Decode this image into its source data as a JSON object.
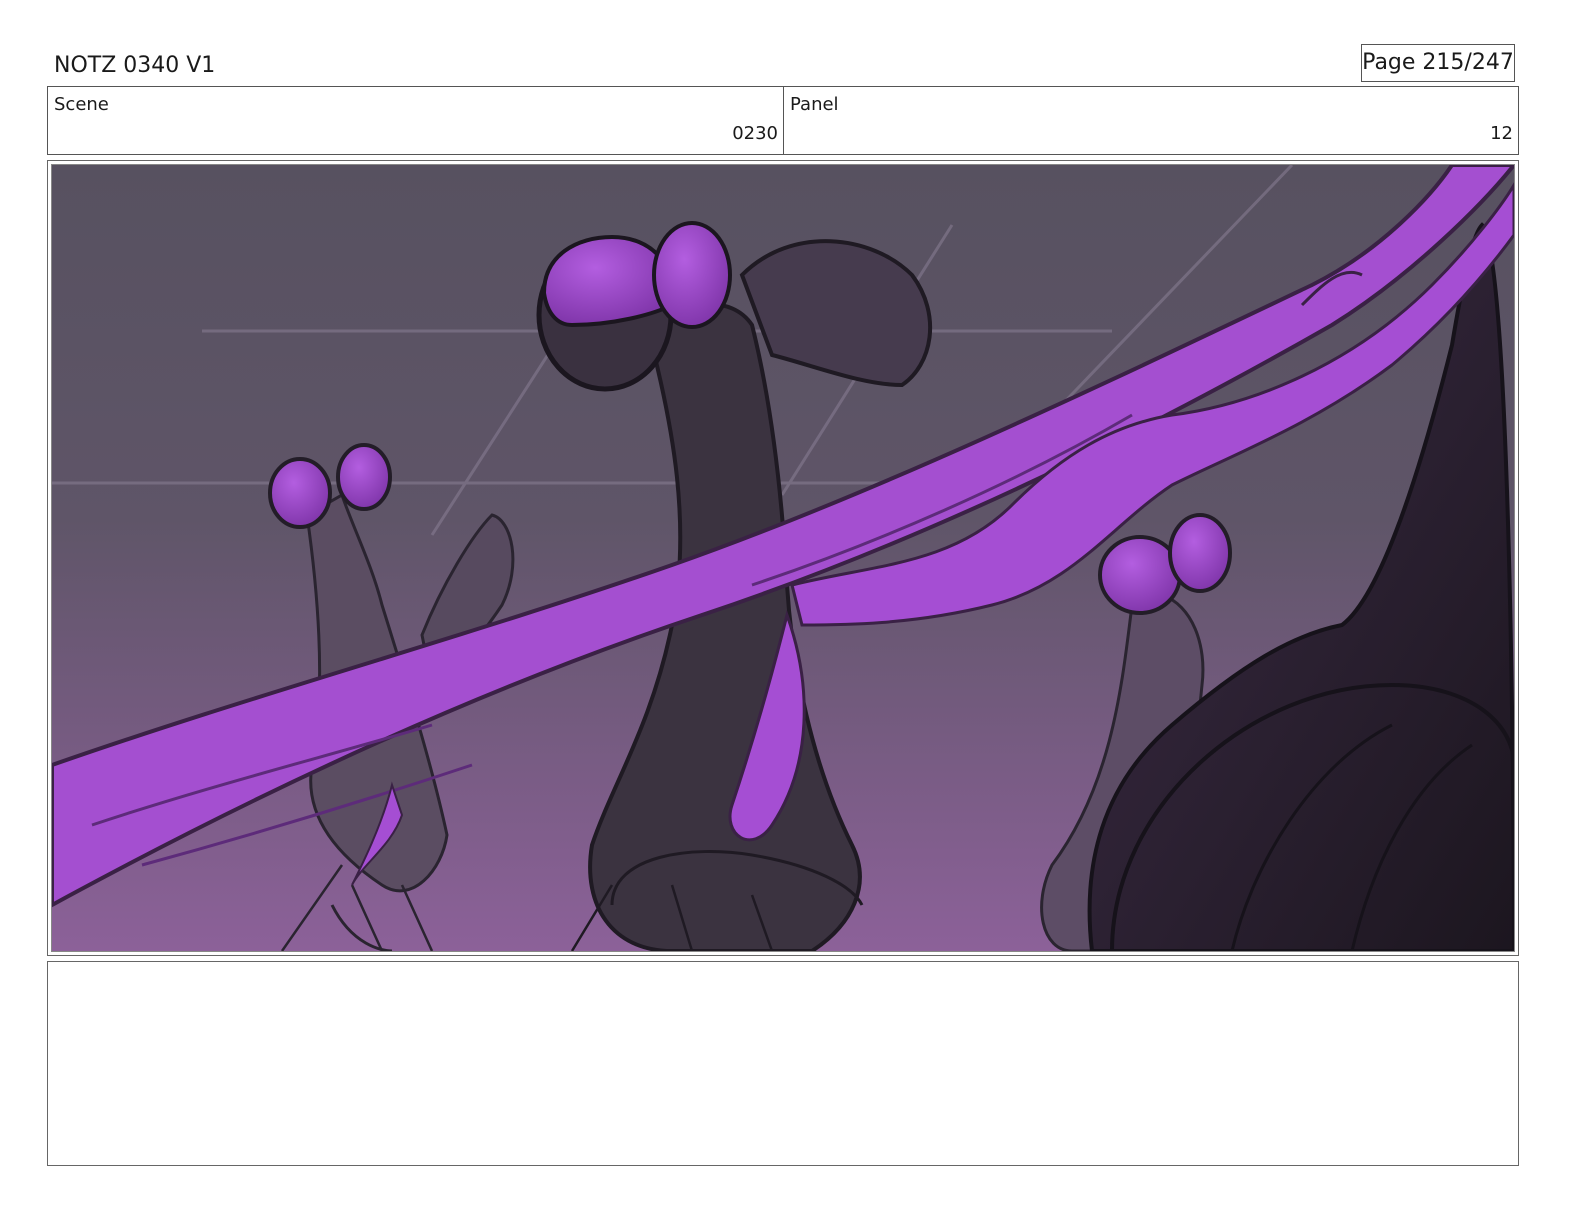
{
  "header": {
    "title": "NOTZ 0340 V1",
    "page_label": "Page 215/247"
  },
  "info": {
    "scene_label": "Scene",
    "scene_value": "0230",
    "panel_label": "Panel",
    "panel_value": "12"
  },
  "frame": {
    "illustration": "storyboard-sketch-purple-creatures-with-beam",
    "colors": {
      "beam": "#a64fd2",
      "bg_top": "#5a5560",
      "bg_bottom": "#8a5e96",
      "creature_dark": "#2f2a33",
      "creature_mid": "#4a3a52"
    }
  },
  "notes": {
    "text": ""
  }
}
